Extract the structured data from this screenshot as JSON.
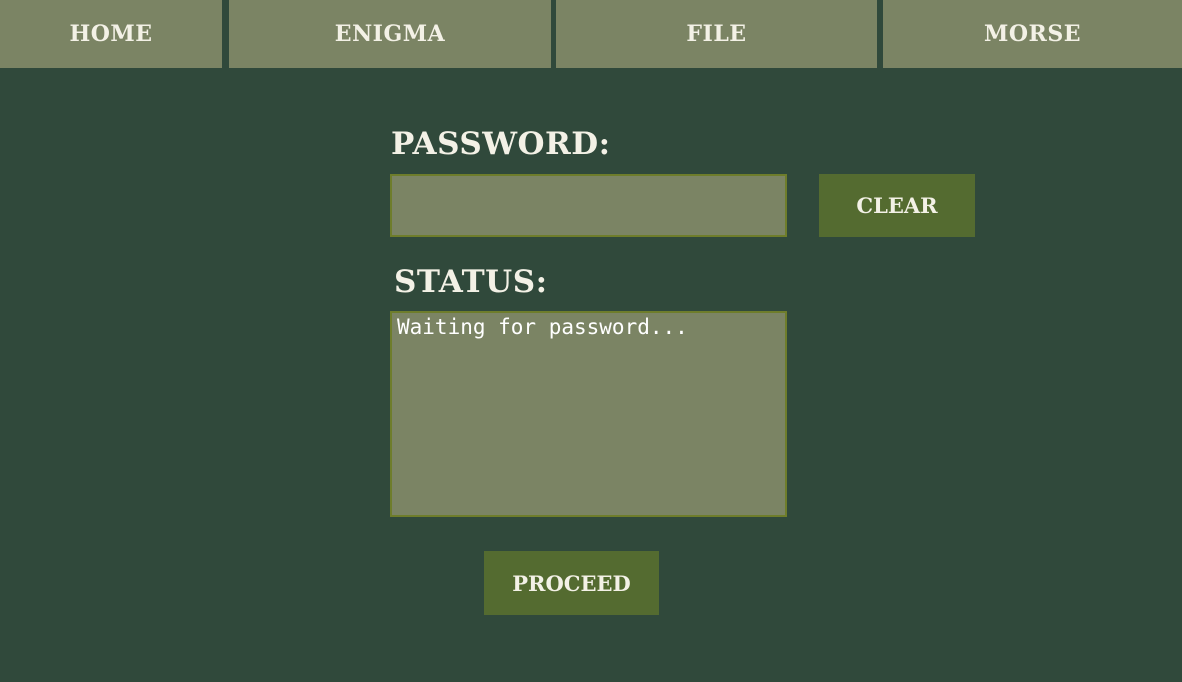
{
  "nav": {
    "home": "HOME",
    "enigma": "ENIGMA",
    "file": "FILE",
    "morse": "MORSE"
  },
  "form": {
    "password_label": "PASSWORD:",
    "password_value": "",
    "clear_label": "CLEAR",
    "status_label": "STATUS:",
    "status_text": "Waiting for password...",
    "proceed_label": "PROCEED"
  },
  "colors": {
    "background": "#30493b",
    "nav_bg": "#7b8464",
    "button_bg": "#546b30",
    "field_border": "#6e7d2b",
    "text": "#f3f1e6"
  }
}
